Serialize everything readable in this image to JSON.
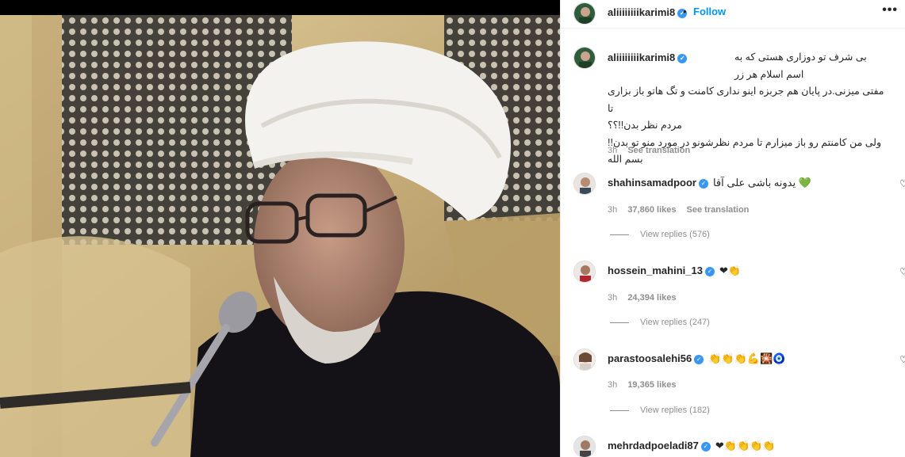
{
  "post": {
    "username": "aliiiiiiiikarimi8",
    "follow_label": "Follow",
    "more_label": "•••",
    "dot": "•"
  },
  "caption": {
    "username": "aliiiiiiiikarimi8",
    "lines": [
      "بی شرف تو دوزاری هستی که به اسم اسلام هر زر",
      "مفتی میزنی.در پایان هم جربزه اینو نداری کامنت و تگ هاتو باز بزاری تا",
      "مردم نظر بدن!!؟؟",
      "ولی من کامنتم رو باز میزارم تا مردم نظرشونو در مورد منو تو بدن!!",
      "بسم الله"
    ],
    "time": "3h",
    "see_translation": "See translation"
  },
  "comments": [
    {
      "username": "shahinsamadpoor",
      "text": "یدونه باشی علی آقا 💚",
      "time": "3h",
      "likes": "37,860 likes",
      "see_translation": "See translation",
      "replies": "View replies (576)"
    },
    {
      "username": "hossein_mahini_13",
      "text": "❤👏",
      "time": "3h",
      "likes": "24,394 likes",
      "replies": "View replies (247)"
    },
    {
      "username": "parastoosalehi56",
      "text": "👏👏👏💪🎇🧿",
      "time": "3h",
      "likes": "19,365 likes",
      "replies": "View replies (182)"
    },
    {
      "username": "mehrdadpoeladi87",
      "text": "❤👏👏👏👏"
    }
  ],
  "icons": {
    "verified": "verified-badge-icon",
    "heart": "heart-outline-icon"
  },
  "colors": {
    "accent": "#0095f6",
    "verified": "#3897f0",
    "muted": "#8e8e8e"
  }
}
